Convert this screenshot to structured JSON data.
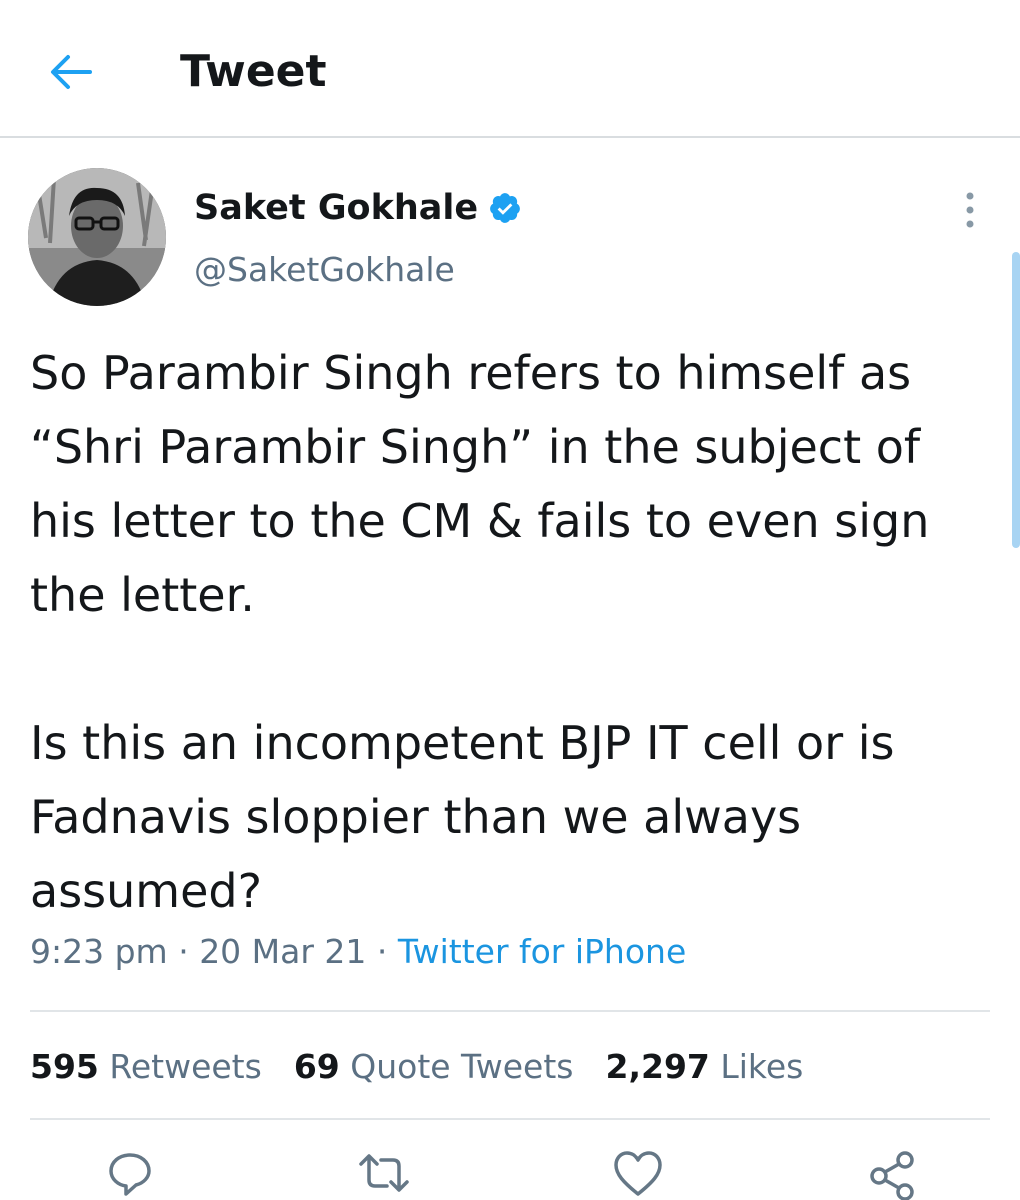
{
  "header": {
    "title": "Tweet",
    "back_icon": "arrow-left-icon"
  },
  "colors": {
    "accent": "#1da1f2",
    "link": "#1b95e0",
    "secondary_text": "#5b7083",
    "divider": "#e1e5e8"
  },
  "author": {
    "name": "Saket Gokhale",
    "handle": "@SaketGokhale",
    "verified": true
  },
  "tweet": {
    "paragraphs": [
      "So Parambir Singh refers to himself as “Shri Parambir Singh” in the subject of his letter to the CM & fails to even sign the letter.",
      "Is this an incompetent BJP IT cell or is Fadnavis sloppier than we always assumed?"
    ],
    "time": "9:23 pm",
    "date": "20 Mar 21",
    "source": "Twitter for iPhone",
    "separator": " · "
  },
  "stats": {
    "retweets_count": "595",
    "retweets_label": "Retweets",
    "quotes_count": "69",
    "quotes_label": "Quote Tweets",
    "likes_count": "2,297",
    "likes_label": "Likes"
  },
  "actions": [
    "reply-icon",
    "retweet-icon",
    "like-icon",
    "share-icon"
  ]
}
